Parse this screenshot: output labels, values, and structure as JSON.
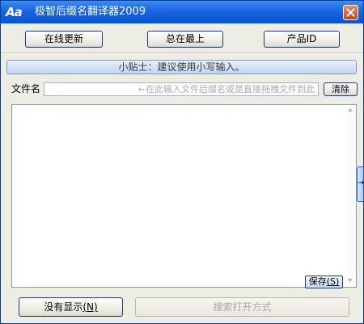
{
  "window": {
    "title": "极智后缀名翻译器2009",
    "icon_text": "Aa",
    "icon": "app-logo-icon",
    "close_icon": "close-icon"
  },
  "toolbar": {
    "online_update": "在线更新",
    "always_on_top": "总在最上",
    "product_id": "产品ID"
  },
  "tip": {
    "text": "小贴士：建议使用小写输入。"
  },
  "file": {
    "label": "文件名",
    "placeholder": "←在此输入文件后缀名或是直接拖拽文件到此",
    "value": "",
    "clear_label": "清除"
  },
  "result": {
    "content": "",
    "save_label": "保存",
    "save_hotkey": "(S)"
  },
  "side_handle": {
    "symbol": "→"
  },
  "bottom": {
    "no_display_label": "没有显示",
    "no_display_hotkey": "(N)",
    "search_open_label": "搜索打开方式"
  },
  "colors": {
    "titlebar": "#0b52d3",
    "background": "#eeede4",
    "tip_bar": "#c3d6f2"
  }
}
